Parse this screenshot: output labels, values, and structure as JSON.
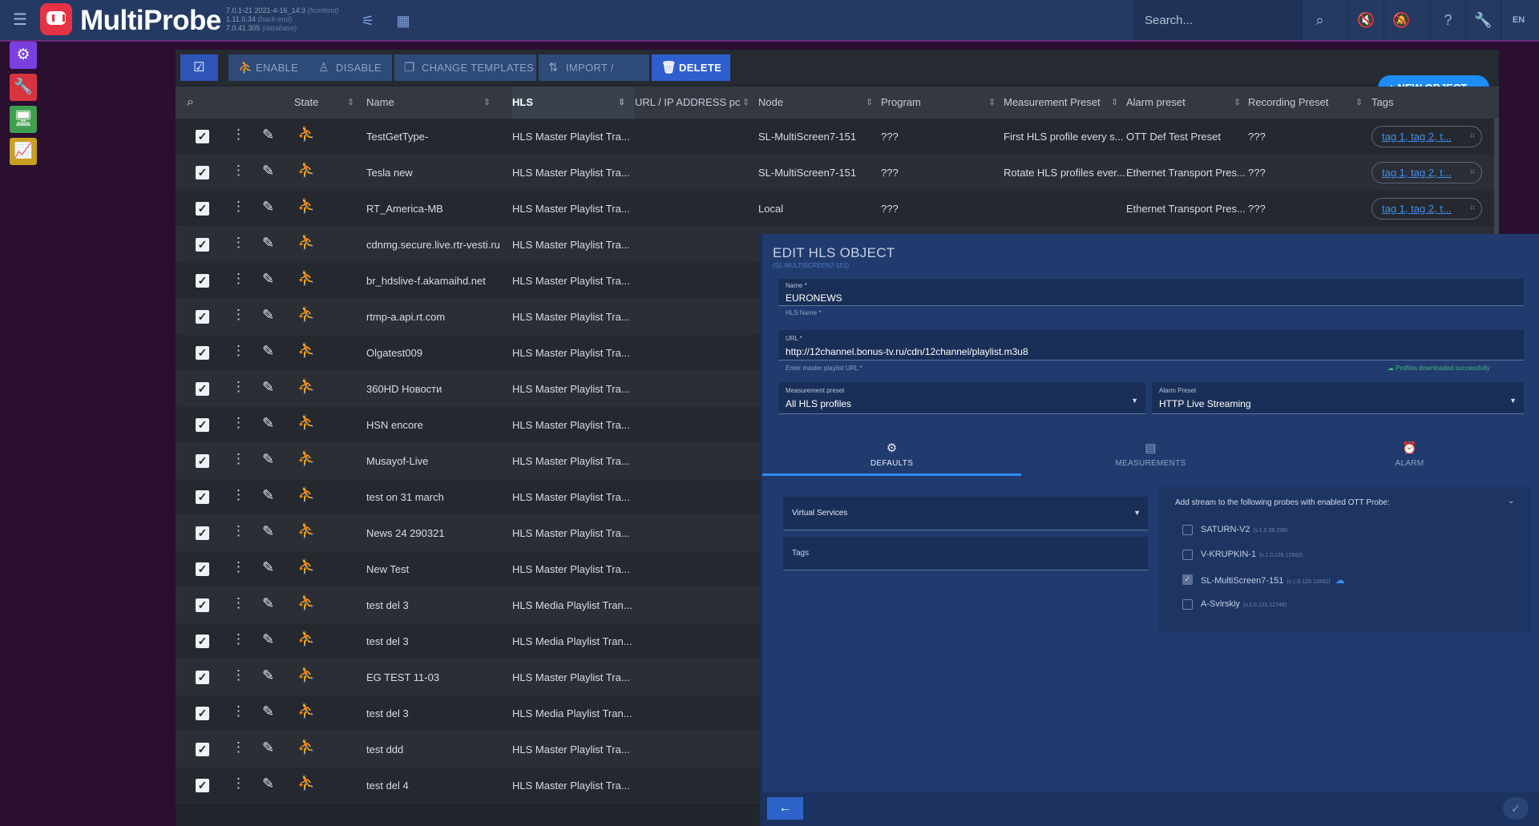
{
  "app": {
    "title": "MultiProbe",
    "versions": [
      {
        "v": "7.0.1-21 2021-4-16_14:3",
        "note": "(frontend)"
      },
      {
        "v": "1.11.0.34",
        "note": "(back-end)"
      },
      {
        "v": "7.0.41.305",
        "note": "(database)"
      }
    ],
    "search_placeholder": "Search...",
    "lang": "EN"
  },
  "toolbar": {
    "enable": "ENABLE",
    "disable": "DISABLE",
    "change_templates": "CHANGE TEMPLATES",
    "import_export": "IMPORT / EXPORT",
    "delete": "DELETE",
    "new_object": "NEW OBJECT"
  },
  "columns": {
    "state": "State",
    "name": "Name",
    "hls": "HLS",
    "url": "URL / IP ADDRESS pc",
    "node": "Node",
    "program": "Program",
    "measurement_preset": "Measurement Preset",
    "alarm_preset": "Alarm preset",
    "recording_preset": "Recording Preset",
    "tags": "Tags"
  },
  "rows": [
    {
      "name": "TestGetType-",
      "type": "HLS Master Playlist Tra...",
      "node": "SL-MultiScreen7-151",
      "program": "???",
      "mpreset": "First HLS profile every s...",
      "apreset": "OTT Def Test Preset",
      "rpreset": "???",
      "tags": "tag 1, tag 2, t..."
    },
    {
      "name": "Tesla new",
      "type": "HLS Master Playlist Tra...",
      "node": "SL-MultiScreen7-151",
      "program": "???",
      "mpreset": "Rotate HLS profiles ever...",
      "apreset": "Ethernet Transport Pres...",
      "rpreset": "???",
      "tags": "tag 1, tag 2, t..."
    },
    {
      "name": "RT_America-MB",
      "type": "HLS Master Playlist Tra...",
      "node": "Local",
      "program": "???",
      "mpreset": "",
      "apreset": "Ethernet Transport Pres...",
      "rpreset": "???",
      "tags": "tag 1, tag 2, t..."
    },
    {
      "name": "cdnmg.secure.live.rtr-vesti.ru",
      "type": "HLS Master Playlist Tra..."
    },
    {
      "name": "br_hdslive-f.akamaihd.net",
      "type": "HLS Master Playlist Tra..."
    },
    {
      "name": "rtmp-a.api.rt.com",
      "type": "HLS Master Playlist Tra..."
    },
    {
      "name": "Olgatest009",
      "type": "HLS Master Playlist Tra..."
    },
    {
      "name": "360HD Новости",
      "type": "HLS Master Playlist Tra..."
    },
    {
      "name": "HSN encore",
      "type": "HLS Master Playlist Tra..."
    },
    {
      "name": "Musayof-Live",
      "type": "HLS Master Playlist Tra..."
    },
    {
      "name": "test on 31 march",
      "type": "HLS Master Playlist Tra..."
    },
    {
      "name": "News 24 290321",
      "type": "HLS Master Playlist Tra..."
    },
    {
      "name": "New Test",
      "type": "HLS Master Playlist Tra..."
    },
    {
      "name": "test del 3",
      "type": "HLS Media Playlist Tran..."
    },
    {
      "name": "test del 3",
      "type": "HLS Media Playlist Tran..."
    },
    {
      "name": "EG TEST 11-03",
      "type": "HLS Master Playlist Tra..."
    },
    {
      "name": "test del 3",
      "type": "HLS Media Playlist Tran..."
    },
    {
      "name": "test ddd",
      "type": "HLS Master Playlist Tra..."
    },
    {
      "name": "test del 4",
      "type": "HLS Master Playlist Tra..."
    }
  ],
  "dialog": {
    "title": "EDIT HLS OBJECT",
    "subtitle": "(SL-MULTISCREEN7-151)",
    "name_label": "Name *",
    "name_value": "EURONEWS",
    "hls_name_hint": "HLS Name *",
    "url_label": "URL *",
    "url_value": "http://12channel.bonus-tv.ru/cdn/12channel/playlist.m3u8",
    "url_hint": "Enter master playlist URL *",
    "url_ok": "Profiles downloaded successfully",
    "measurement_label": "Measurement preset",
    "measurement_value": "All HLS profiles",
    "alarm_label": "Alarm Preset",
    "alarm_value": "HTTP Live Streaming",
    "tabs": [
      "DEFAULTS",
      "MEASUREMENTS",
      "ALARM"
    ],
    "virtual_services": "Virtual Services",
    "tags": "Tags",
    "probes_title": "Add stream to the following probes with enabled OTT Probe:",
    "probes": [
      {
        "name": "SATURN-V2",
        "version": "(v.1.0.38.298)",
        "checked": false
      },
      {
        "name": "V-KRUPKIN-1",
        "version": "(v.1.0.126.12862)",
        "checked": false
      },
      {
        "name": "SL-MultiScreen7-151",
        "version": "(v.1.0.126.12862)",
        "checked": true
      },
      {
        "name": "A-Svirskiy",
        "version": "(v.1.0.121.12748)",
        "checked": false
      }
    ]
  }
}
